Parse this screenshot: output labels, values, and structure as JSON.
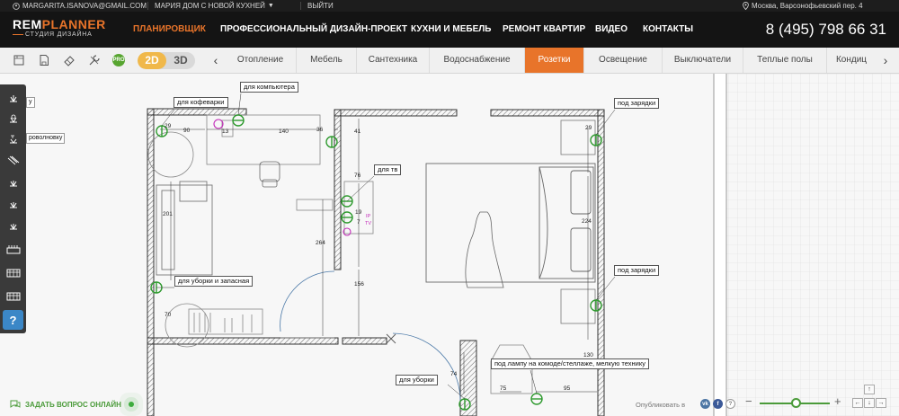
{
  "account": {
    "email": "MARGARITA.ISANOVA@GMAIL.COM",
    "project": "МАРИЯ ДОМ С НОВОЙ КУХНЕЙ",
    "logout": "ВЫЙТИ",
    "location": "Москва, Варсонофьевский пер. 4"
  },
  "brand": {
    "logo_left": "REM",
    "logo_right": "PLANNER",
    "subtitle": "СТУДИЯ ДИЗАЙНА",
    "accent": "#e8742a"
  },
  "nav": [
    {
      "label": "ПЛАНИРОВЩИК",
      "active": true
    },
    {
      "label": "ПРОФЕССИОНАЛЬНЫЙ ДИЗАЙН-ПРОЕКТ"
    },
    {
      "label": "КУХНИ И МЕБЕЛЬ"
    },
    {
      "label": "РЕМОНТ КВАРТИР"
    },
    {
      "label": "ВИДЕО"
    },
    {
      "label": "КОНТАКТЫ"
    }
  ],
  "phone": "8 (495) 798 66 31",
  "toolbar": {
    "pro_label": "PRO",
    "mode_2d": "2D",
    "mode_3d": "3D",
    "tabs": [
      {
        "label": "Отопление"
      },
      {
        "label": "Мебель"
      },
      {
        "label": "Сантехника"
      },
      {
        "label": "Водоснабжение"
      },
      {
        "label": "Розетки",
        "active": true
      },
      {
        "label": "Освещение"
      },
      {
        "label": "Выключатели"
      },
      {
        "label": "Теплые полы"
      },
      {
        "label": "Кондиц"
      }
    ]
  },
  "palette": {
    "tooltip_1": "у",
    "tooltip_2": "роволновку",
    "help": "?"
  },
  "plan": {
    "labels": {
      "coffee": "для кофеварки",
      "computer": "для компьютера",
      "charge_1": "под зарядки",
      "tv": "для тв",
      "charge_2": "под зарядки",
      "cleaning_spare": "для уборки и запасная",
      "cleaning": "для уборки",
      "lamp": "под лампу на комоде/стеллаже, мелкую технику"
    },
    "dims": {
      "d29a": "29",
      "d90": "90",
      "d13": "13",
      "d140": "140",
      "d36": "36",
      "d41": "41",
      "d29b": "29",
      "d76": "76",
      "d224": "224",
      "d201": "201",
      "d264": "264",
      "d19": "19",
      "d7": "7",
      "d156": "156",
      "d70": "70",
      "d130": "130",
      "d74": "74",
      "d75": "75",
      "d95": "95"
    },
    "tv_code_1": "IP",
    "tv_code_2": "TV"
  },
  "footer": {
    "ask": "ЗАДАТЬ ВОПРОС ОНЛАЙН",
    "publish": "Опубликовать в",
    "vk": "vk",
    "fb": "f",
    "help": "?",
    "zoom_minus": "−",
    "zoom_plus": "+",
    "zoom_level": 0.52
  }
}
